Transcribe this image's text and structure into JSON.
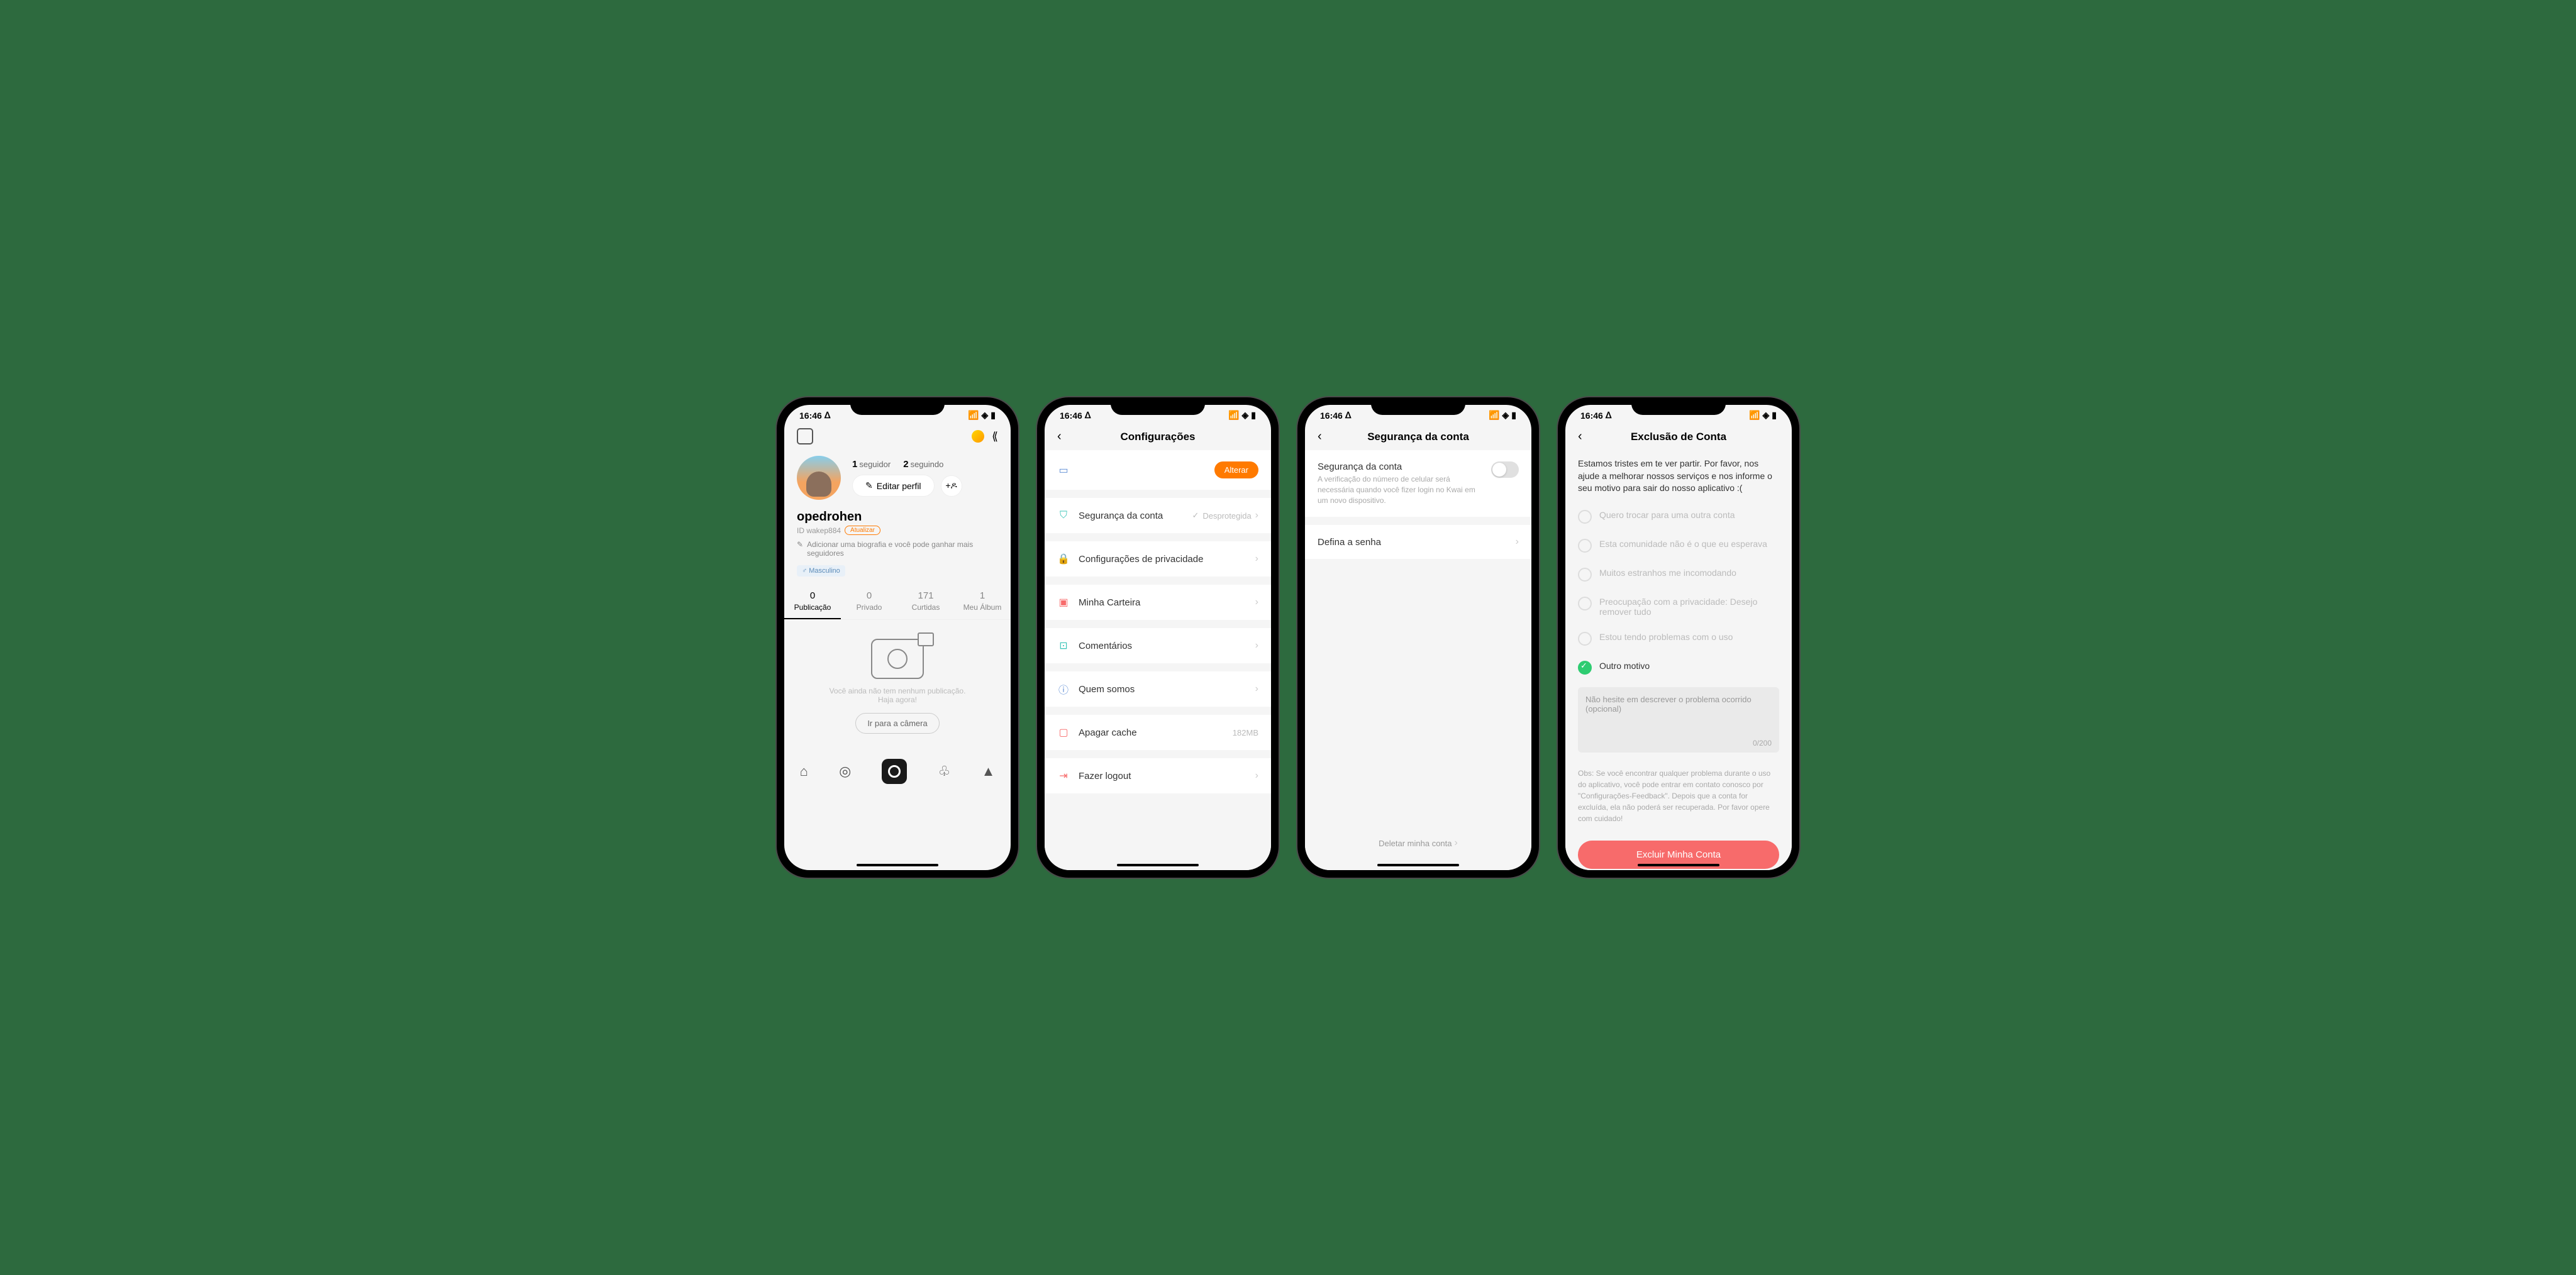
{
  "status": {
    "time": "16:46"
  },
  "screen1": {
    "followers": {
      "count": "1",
      "label": "seguidor"
    },
    "following": {
      "count": "2",
      "label": "seguindo"
    },
    "edit_profile": "Editar perfil",
    "username": "opedrohen",
    "user_id": "ID wakep884",
    "update_badge": "Atualizar",
    "bio_hint": "Adicionar uma biografia e você pode ganhar mais seguidores",
    "gender": "Masculino",
    "tabs": [
      {
        "count": "0",
        "label": "Publicação"
      },
      {
        "count": "0",
        "label": "Privado"
      },
      {
        "count": "171",
        "label": "Curtidas"
      },
      {
        "count": "1",
        "label": "Meu Álbum"
      }
    ],
    "empty_text": "Você ainda não tem nenhum publicação.\nHaja agora!",
    "camera_btn": "Ir para a câmera"
  },
  "screen2": {
    "title": "Configurações",
    "alterar": "Alterar",
    "items": {
      "security": "Segurança da conta",
      "security_status": "Desprotegida",
      "privacy": "Configurações de privacidade",
      "wallet": "Minha Carteira",
      "comments": "Comentários",
      "about": "Quem somos",
      "cache": "Apagar cache",
      "cache_size": "182MB",
      "logout": "Fazer logout"
    }
  },
  "screen3": {
    "title": "Segurança da conta",
    "section_title": "Segurança da conta",
    "section_desc": "A verificação do número de celular será necessária quando você fizer login no Kwai em um novo dispositivo.",
    "password": "Defina a senha",
    "delete": "Deletar minha conta"
  },
  "screen4": {
    "title": "Exclusão de Conta",
    "intro": "Estamos tristes em te ver partir. Por favor, nos ajude a melhorar nossos serviços e nos informe o seu motivo para sair do nosso aplicativo :(",
    "options": [
      "Quero trocar para uma outra conta",
      "Esta comunidade não é o que eu esperava",
      "Muitos estranhos me incomodando",
      "Preocupação com a privacidade: Desejo remover tudo",
      "Estou tendo problemas com o uso",
      "Outro motivo"
    ],
    "placeholder": "Não hesite em descrever o problema ocorrido (opcional)",
    "counter": "0/200",
    "note": "Obs: Se você encontrar qualquer problema durante o uso do aplicativo, você pode entrar em contato conosco por \"Configurações-Feedback\". Depois que a conta for excluída, ela não poderá ser recuperada. Por favor opere com cuidado!",
    "delete_btn": "Excluir Minha Conta"
  }
}
